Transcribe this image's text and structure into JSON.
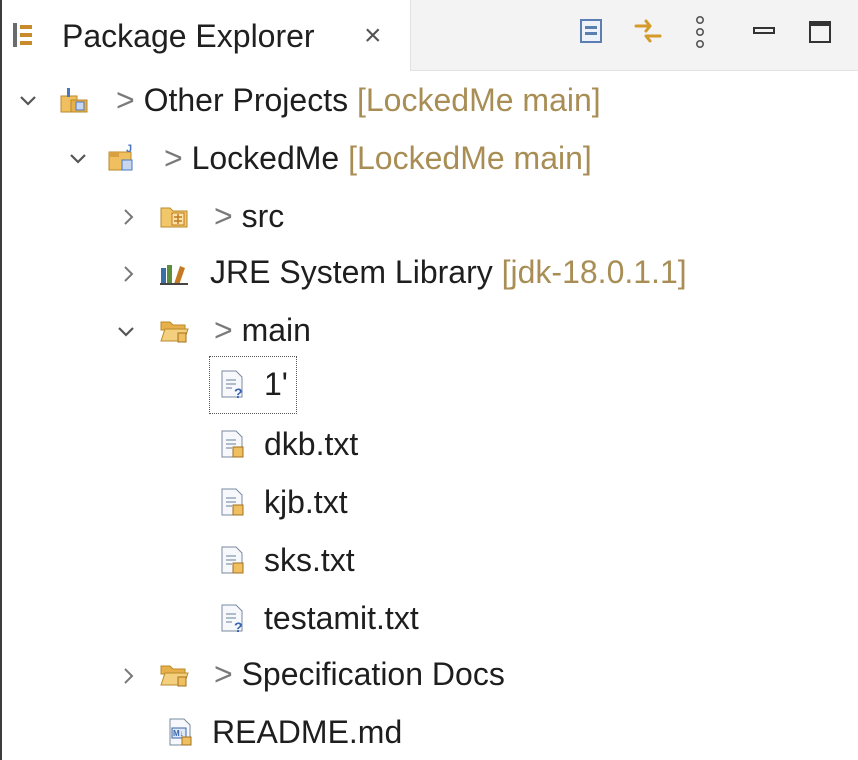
{
  "view": {
    "title": "Package Explorer",
    "close_symbol": "×",
    "toolbar": [
      "collapse-all-icon",
      "link-with-editor-icon",
      "view-menu-icon",
      "minimize-icon",
      "maximize-icon"
    ]
  },
  "tree": {
    "other_projects": {
      "prefix": ">",
      "name": "Other Projects",
      "decoration": "[LockedMe main]",
      "expanded": true
    },
    "lockedme": {
      "prefix": ">",
      "name": "LockedMe",
      "decoration": "[LockedMe main]",
      "expanded": true
    },
    "src": {
      "prefix": ">",
      "name": "src",
      "expanded": false
    },
    "jre": {
      "name": "JRE System Library",
      "decoration": "[jdk-18.0.1.1]",
      "expanded": false
    },
    "main": {
      "prefix": ">",
      "name": "main",
      "expanded": true
    },
    "file_1": {
      "name": "1'"
    },
    "dkb": {
      "name": "dkb.txt"
    },
    "kjb": {
      "name": "kjb.txt"
    },
    "sks": {
      "name": "sks.txt"
    },
    "testamit": {
      "name": "testamit.txt"
    },
    "spec_docs": {
      "prefix": ">",
      "name": "Specification Docs",
      "expanded": false
    },
    "readme": {
      "name": "README.md"
    }
  }
}
